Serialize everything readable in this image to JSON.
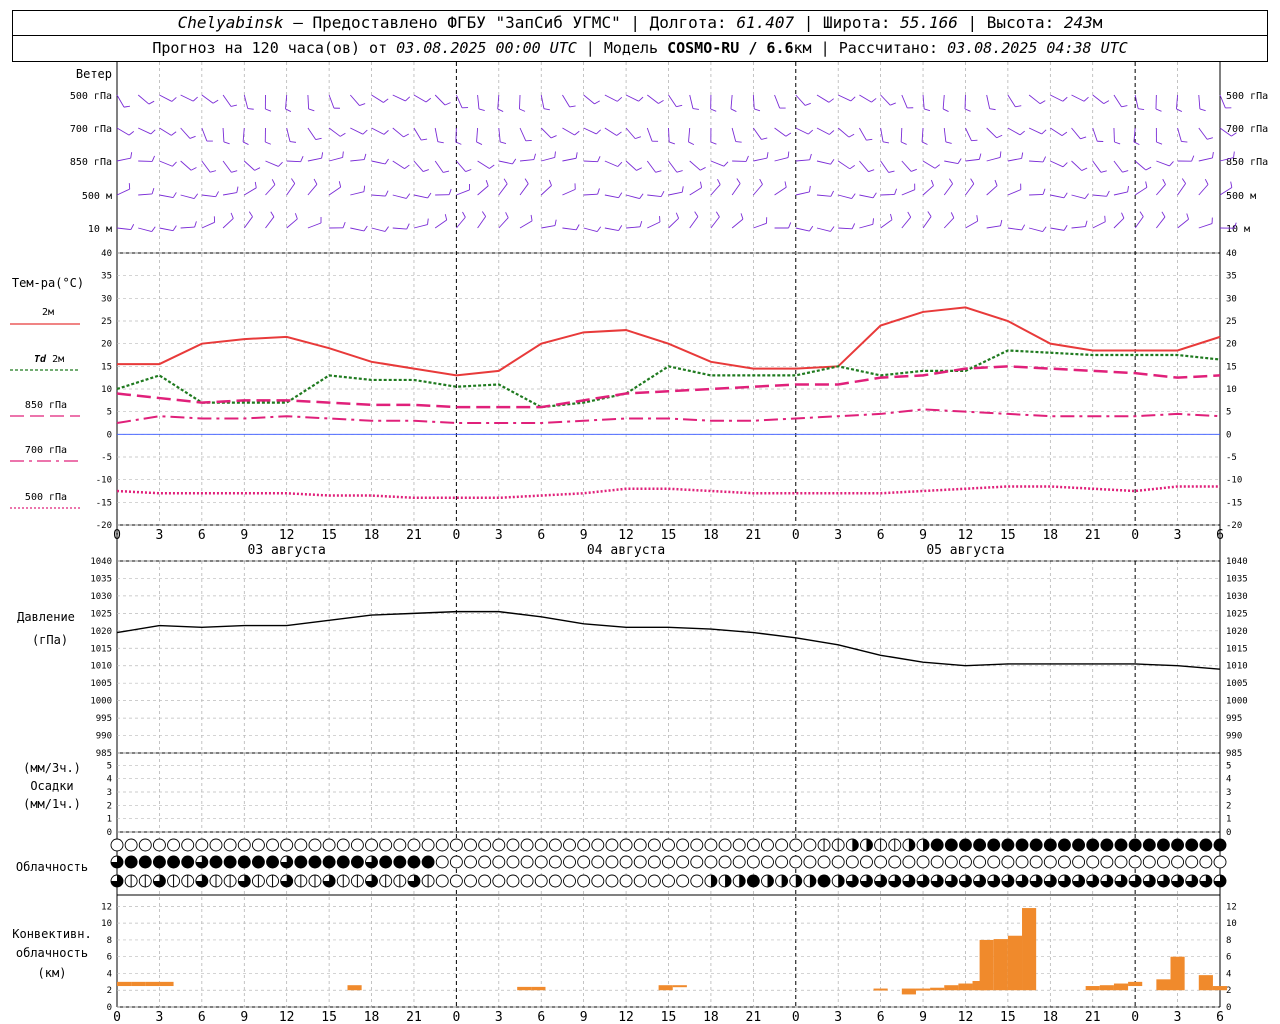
{
  "header": {
    "city": "Chelyabinsk",
    "provider": "— Предоставлено ФГБУ \"ЗапСиб УГМС\"",
    "lon_label": "Долгота:",
    "lon": "61.407",
    "lat_label": "Широта:",
    "lat": "55.166",
    "alt_label": "Высота:",
    "alt": "243",
    "alt_unit": "м",
    "forecast_label": "Прогноз на 120 часа(ов) от",
    "forecast_date": "03.08.2025 00:00 UTC",
    "model_label": "Модель",
    "model": "COSMO-RU / 6.6",
    "model_unit": "км",
    "calc_label": "Рассчитано:",
    "calc_date": "03.08.2025 04:38 UTC"
  },
  "labels": {
    "wind": "Ветер",
    "levels": [
      "500 гПа",
      "700 гПа",
      "850 гПа",
      "500 м",
      "10  м"
    ],
    "temp": "Тем-ра(°C)",
    "t2m": "2м",
    "td": "Td",
    "td2": "2м",
    "t850": "850 гПа",
    "t700": "700 гПа",
    "t500": "500 гПа",
    "pressure": "Давление",
    "pressure_unit": "(гПа)",
    "precip1": "(мм/3ч.)",
    "precip2": "Осадки",
    "precip3": "(мм/1ч.)",
    "cloud": "Облачность",
    "conv1": "Конвективн.",
    "conv2": "облачность",
    "conv3": "(км)"
  },
  "x_ticks": [
    "0",
    "3",
    "6",
    "9",
    "12",
    "15",
    "18",
    "21",
    "0",
    "3",
    "6",
    "9",
    "12",
    "15",
    "18",
    "21",
    "0",
    "3",
    "6",
    "9",
    "12",
    "15",
    "18",
    "21",
    "0",
    "3",
    "6"
  ],
  "days": [
    "03 августа",
    "04 августа",
    "05 августа"
  ],
  "colors": {
    "t2m": "#e83a3a",
    "td": "#1f7a1f",
    "upper": "#e0207a",
    "wind": "#7a2bd6",
    "conv": "#f08a2c",
    "pres": "#000000"
  },
  "chart_data": [
    {
      "type": "line",
      "title": "Тем-ра(°C)",
      "x": [
        0,
        3,
        6,
        9,
        12,
        15,
        18,
        21,
        24,
        27,
        30,
        33,
        36,
        39,
        42,
        45,
        48,
        51,
        54,
        57,
        60,
        63,
        66,
        69,
        72,
        75,
        78
      ],
      "ylim": [
        -20,
        40
      ],
      "series": [
        {
          "name": "2м",
          "values": [
            15.5,
            15.5,
            20,
            21,
            21.5,
            19,
            16,
            14.5,
            13,
            14,
            20,
            22.5,
            23,
            20,
            16,
            14.5,
            14.5,
            15,
            24,
            27,
            28,
            25,
            20,
            18.5,
            18.5,
            18.5,
            21.5
          ]
        },
        {
          "name": "Td 2м",
          "values": [
            10,
            13,
            7,
            7,
            7,
            13,
            12,
            12,
            10.5,
            11,
            6,
            7,
            9,
            15,
            13,
            13,
            13,
            15,
            13,
            14,
            14,
            18.5,
            18,
            17.5,
            17.5,
            17.5,
            16.5
          ]
        },
        {
          "name": "850 гПа",
          "values": [
            9,
            8,
            7,
            7.5,
            7.5,
            7,
            6.5,
            6.5,
            6,
            6,
            6,
            7.5,
            9,
            9.5,
            10,
            10.5,
            11,
            11,
            12.5,
            13,
            14.5,
            15,
            14.5,
            14,
            13.5,
            12.5,
            13
          ]
        },
        {
          "name": "700 гПа",
          "values": [
            2.5,
            4,
            3.5,
            3.5,
            4,
            3.5,
            3,
            3,
            2.5,
            2.5,
            2.5,
            3,
            3.5,
            3.5,
            3,
            3,
            3.5,
            4,
            4.5,
            5.5,
            5,
            4.5,
            4,
            4,
            4,
            4.5,
            4
          ]
        },
        {
          "name": "500 гПа",
          "values": [
            -12.5,
            -13,
            -13,
            -13,
            -13,
            -13.5,
            -13.5,
            -14,
            -14,
            -14,
            -13.5,
            -13,
            -12,
            -12,
            -12.5,
            -13,
            -13,
            -13,
            -13,
            -12.5,
            -12,
            -11.5,
            -11.5,
            -12,
            -12.5,
            -11.5,
            -11.5
          ]
        }
      ]
    },
    {
      "type": "line",
      "title": "Давление",
      "x": [
        0,
        3,
        6,
        9,
        12,
        15,
        18,
        21,
        24,
        27,
        30,
        33,
        36,
        39,
        42,
        45,
        48,
        51,
        54,
        57,
        60,
        63,
        66,
        69,
        72,
        75,
        78
      ],
      "ylim": [
        985,
        1040
      ],
      "series": [
        {
          "name": "Давление",
          "values": [
            1019.5,
            1021.5,
            1021,
            1021.5,
            1021.5,
            1023,
            1024.5,
            1025,
            1025.5,
            1025.5,
            1024,
            1022,
            1021,
            1021,
            1020.5,
            1019.5,
            1018,
            1016,
            1013,
            1011,
            1010,
            1010.5,
            1010.5,
            1010.5,
            1010.5,
            1010,
            1009
          ]
        }
      ]
    },
    {
      "type": "bar",
      "title": "Конвективн. облачность (км)",
      "ylim": [
        0,
        13
      ],
      "series": [
        {
          "name": "base",
          "values": [
            2.5,
            2.5,
            2.5,
            2.5,
            2,
            2,
            2,
            2,
            2.5,
            2,
            1.5,
            2,
            2,
            2,
            2,
            2,
            2,
            2,
            2,
            2,
            2,
            2,
            2,
            2.5,
            2,
            2,
            2,
            2
          ]
        },
        {
          "name": "top",
          "values": [
            3,
            3,
            3,
            3,
            2.6,
            2.4,
            2.4,
            2.6,
            2.6,
            2.2,
            2.2,
            2.2,
            2.3,
            2.6,
            2.8,
            3.1,
            8,
            8.1,
            8.5,
            11.8,
            2.5,
            2.6,
            2.8,
            3,
            3.3,
            6,
            3.8,
            2.5
          ]
        }
      ],
      "x": [
        0.5,
        1.5,
        2.5,
        3.5,
        16.8,
        28.8,
        29.8,
        38.8,
        39.8,
        54,
        56,
        57,
        58,
        59,
        60,
        61,
        61.5,
        62.5,
        63.5,
        64.5,
        69,
        70,
        71,
        72,
        74,
        75,
        77,
        78
      ]
    }
  ]
}
